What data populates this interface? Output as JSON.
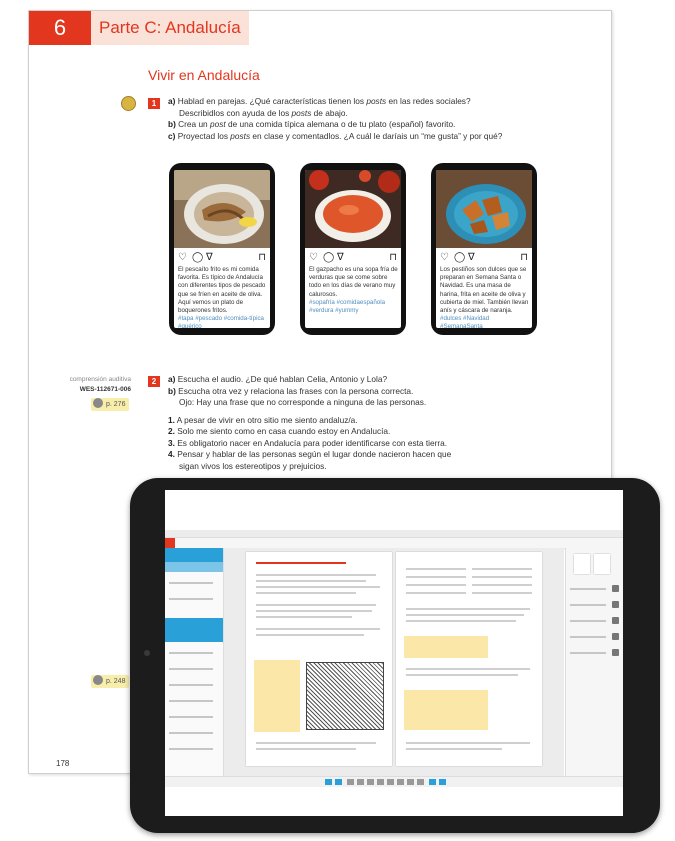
{
  "book": {
    "chapter_number": "6",
    "chapter_title": "Parte C: Andalucía",
    "section_title": "Vivir en Andalucía",
    "page_number": "178"
  },
  "exercise1": {
    "number": "1",
    "a_label": "a)",
    "a_text_1": "Hablad en parejas. ¿Qué características tienen los ",
    "a_text_posts": "posts",
    "a_text_2": " en las redes sociales?",
    "a_text_3": "Describidlos con ayuda de los ",
    "a_text_4": " de abajo.",
    "b_label": "b)",
    "b_text_1": "Crea un ",
    "b_text_post": "post",
    "b_text_2": " de una comida típica alemana o de tu plato (español) favorito.",
    "c_label": "c)",
    "c_text_1": "Proyectad los ",
    "c_text_2": " en clase y comentadlos. ¿A cuál le daríais un “me gusta” y por qué?"
  },
  "posts": [
    {
      "caption": "El pescaíto frito es mi comida favorita. Es típico de Andalucía con diferentes tipos de pescado que se fríen en aceite de oliva. Aquí vemos un plato de boquerones fritos.",
      "tags": "#tapa #pescado #comida-típica #quérico"
    },
    {
      "caption": "El gazpacho es una sopa fría de verduras que se come sobre todo en los días de verano muy calurosos.",
      "tags": "#sopafría #comidaespañola #verdura #yummy"
    },
    {
      "caption": "Los pestiños son dulces que se preparan en Semana Santa o Navidad. Es una masa de harina, frita en aceite de oliva y cubierta de miel. También llevan anís y cáscara de naranja.",
      "tags": "#dulces #Navidad #SemanaSanta"
    }
  ],
  "post_icons": {
    "like": "♡",
    "comment": "◯",
    "share": "∇",
    "save": "⊓"
  },
  "exercise2": {
    "side_label": "comprensión auditiva",
    "side_code": "WES-112671-006",
    "page_ref": "p. 276",
    "number": "2",
    "a_label": "a)",
    "a_text": "Escucha el audio. ¿De qué hablan Celia, Antonio y Lola?",
    "b_label": "b)",
    "b_text": "Escucha otra vez y relaciona las frases con la persona correcta.",
    "note": "Ojo: Hay una frase que no corresponde a ninguna de las personas.",
    "items": [
      {
        "num": "1.",
        "text": "A pesar de vivir en otro sitio me siento andaluz/a."
      },
      {
        "num": "2.",
        "text": "Solo me siento como en casa cuando estoy en Andalucía."
      },
      {
        "num": "3.",
        "text": "Es obligatorio nacer en Andalucía para poder identificarse con esta tierra."
      },
      {
        "num": "4.",
        "text": "Pensar y hablar de las personas según el lugar donde nacieron hacen que"
      },
      {
        "num": "",
        "text": "sigan vivos los estereotipos y prejuicios."
      }
    ]
  },
  "lower_ref": "p. 248",
  "colors": {
    "accent": "#e2361f",
    "accent_light": "#fbe2d9",
    "hashtag": "#4f8fc0",
    "highlight": "#f7eeab",
    "tablet_frame": "#1c1c1c",
    "app_blue": "#2aa0d8"
  }
}
